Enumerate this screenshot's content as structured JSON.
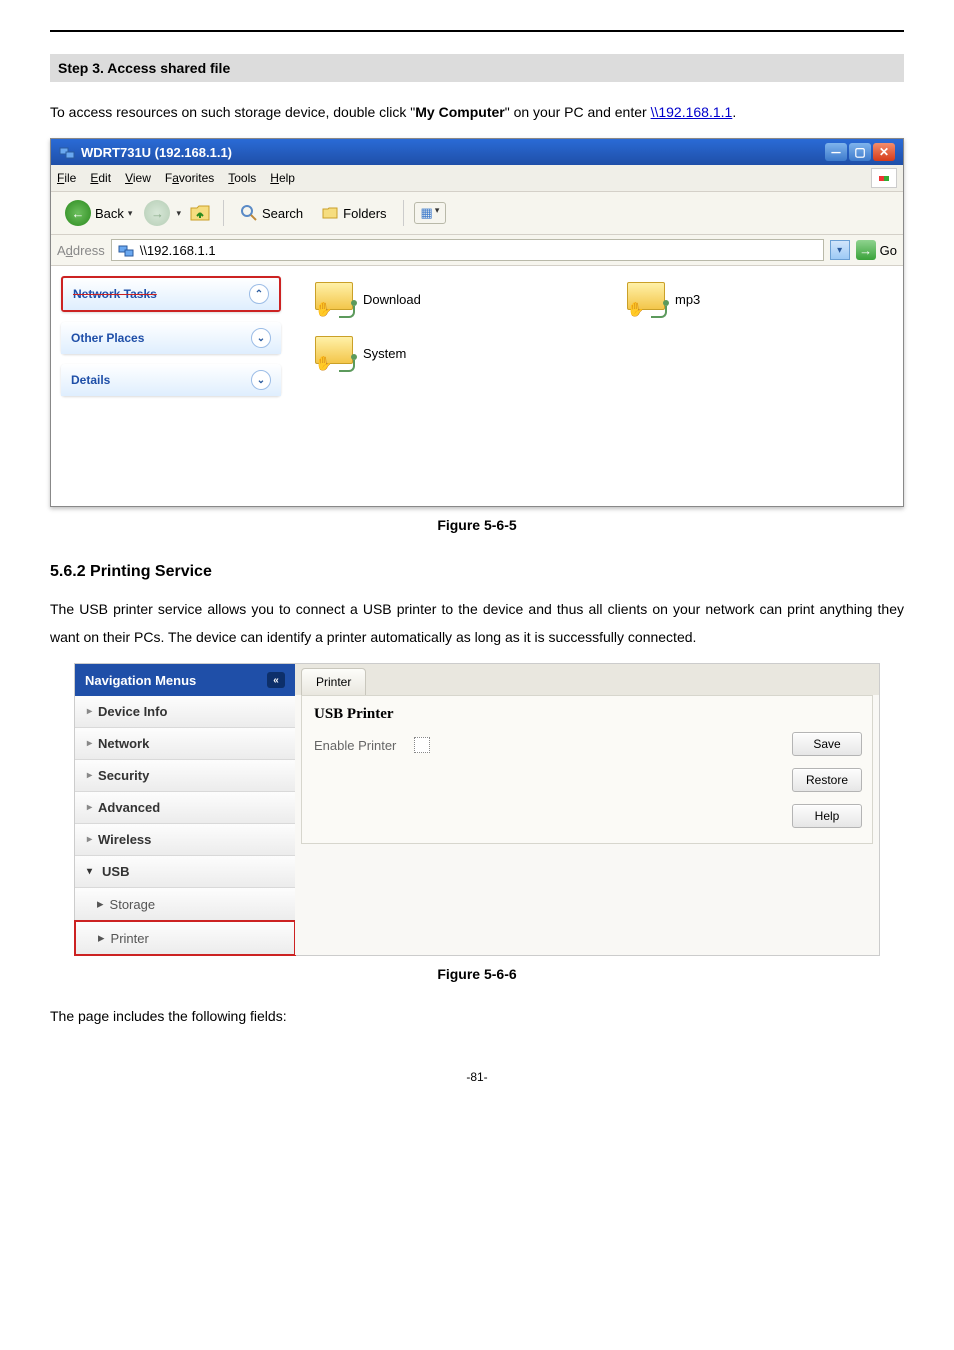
{
  "step_bar": "Step 3.   Access shared file",
  "intro_pre": "To access resources on such storage device, double click \"",
  "intro_bold": "My Computer",
  "intro_post": "\" on your PC and enter ",
  "intro_link": "\\\\192.168.1.1",
  "intro_end": ".",
  "figure1": "Figure 5-6-5",
  "section_heading": "5.6.2  Printing Service",
  "printing_text": "The USB printer service allows you to connect a USB printer to the device and thus all clients on your network can print anything they want on their PCs. The device can identify a printer automatically as long as it is successfully connected.",
  "figure2": "Figure 5-6-6",
  "post_text": "The page includes the following fields:",
  "page_number": "-81-",
  "win": {
    "title": "WDRT731U (192.168.1.1)",
    "menus": {
      "file": "File",
      "edit": "Edit",
      "view": "View",
      "fav": "Favorites",
      "tools": "Tools",
      "help": "Help"
    },
    "toolbar": {
      "back": "Back",
      "search": "Search",
      "folders": "Folders"
    },
    "address_label": "Address",
    "address_value": "\\\\192.168.1.1",
    "go": "Go",
    "tasks": {
      "network": "Network Tasks",
      "other": "Other Places",
      "details": "Details"
    },
    "shares": {
      "download": "Download",
      "mp3": "mp3",
      "system": "System"
    }
  },
  "nav": {
    "title": "Navigation Menus",
    "items": {
      "device": "Device Info",
      "network": "Network",
      "security": "Security",
      "advanced": "Advanced",
      "wireless": "Wireless",
      "usb": "USB",
      "storage": "Storage",
      "printer": "Printer"
    }
  },
  "panel": {
    "tab": "Printer",
    "title": "USB Printer",
    "enable": "Enable Printer",
    "save": "Save",
    "restore": "Restore",
    "help": "Help"
  }
}
